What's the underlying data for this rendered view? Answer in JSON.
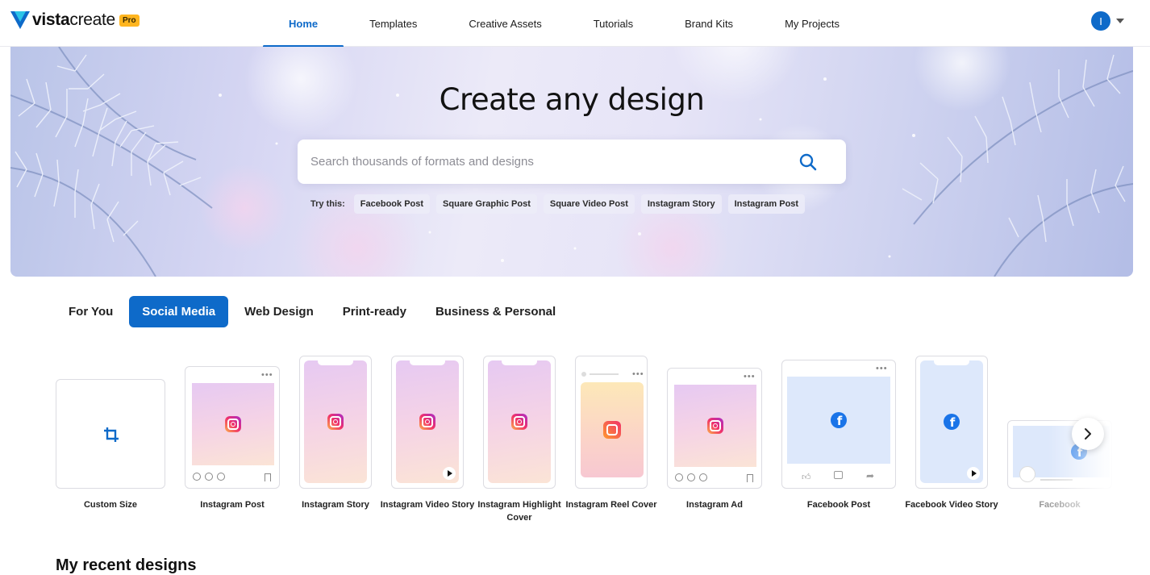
{
  "brand": {
    "name_bold": "vista",
    "name_light": "create",
    "badge": "Pro",
    "accent": "#0e6ac9",
    "badge_color": "#ffb51f"
  },
  "nav": {
    "items": [
      {
        "label": "Home",
        "active": true
      },
      {
        "label": "Templates"
      },
      {
        "label": "Creative Assets"
      },
      {
        "label": "Tutorials"
      },
      {
        "label": "Brand Kits"
      },
      {
        "label": "My Projects"
      }
    ],
    "avatar_initial": "I"
  },
  "hero": {
    "title": "Create any design",
    "search_placeholder": "Search thousands of formats and designs",
    "try_label": "Try this:",
    "suggestions": [
      "Facebook Post",
      "Square Graphic Post",
      "Square Video Post",
      "Instagram Story",
      "Instagram Post"
    ]
  },
  "categories": {
    "tabs": [
      {
        "label": "For You"
      },
      {
        "label": "Social Media",
        "active": true
      },
      {
        "label": "Web Design"
      },
      {
        "label": "Print-ready"
      },
      {
        "label": "Business & Personal"
      }
    ]
  },
  "formats": {
    "items": [
      {
        "label": "Custom Size",
        "icon": "crop-icon"
      },
      {
        "label": "Instagram Post",
        "icon": "instagram-icon"
      },
      {
        "label": "Instagram Story",
        "icon": "instagram-icon"
      },
      {
        "label": "Instagram Video Story",
        "icon": "instagram-icon"
      },
      {
        "label": "Instagram Highlight Cover",
        "icon": "instagram-icon"
      },
      {
        "label": "Instagram Reel Cover",
        "icon": "reel-icon"
      },
      {
        "label": "Instagram Ad",
        "icon": "instagram-icon"
      },
      {
        "label": "Facebook Post",
        "icon": "facebook-icon"
      },
      {
        "label": "Facebook Video Story",
        "icon": "facebook-icon"
      },
      {
        "label": "Facebook",
        "icon": "facebook-icon"
      }
    ]
  },
  "section": {
    "more_title": "My recent designs"
  }
}
